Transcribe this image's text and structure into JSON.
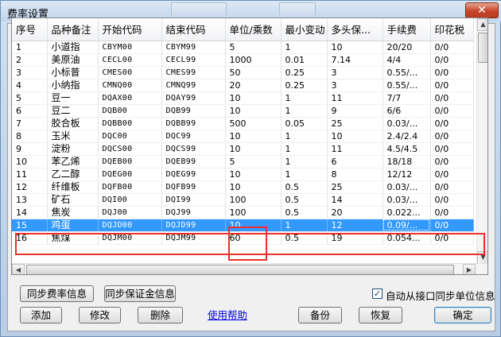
{
  "window": {
    "title": "费率设置",
    "background_tab": "费率",
    "close_glyph": "✕"
  },
  "table": {
    "columns": [
      "序号",
      "品种备注",
      "开始代码",
      "结束代码",
      "单位/乘数",
      "最小变动",
      "多头保...",
      "手续费",
      "印花税"
    ],
    "rows": [
      [
        "1",
        "小道指",
        "CBYM00",
        "CBYM99",
        "5",
        "1",
        "10",
        "20/20",
        "0/0"
      ],
      [
        "2",
        "美原油",
        "CECL00",
        "CECL99",
        "1000",
        "0.01",
        "7.14",
        "4/4",
        "0/0"
      ],
      [
        "3",
        "小标普",
        "CMES00",
        "CMES99",
        "50",
        "0.25",
        "3",
        "0.55/...",
        "0/0"
      ],
      [
        "4",
        "小纳指",
        "CMNQ00",
        "CMNQ99",
        "20",
        "0.25",
        "3",
        "0.55/...",
        "0/0"
      ],
      [
        "5",
        "豆一",
        "DQAX00",
        "DQAY99",
        "10",
        "1",
        "11",
        "7/7",
        "0/0"
      ],
      [
        "6",
        "豆二",
        "DQB00",
        "DQB99",
        "10",
        "1",
        "9",
        "6/6",
        "0/0"
      ],
      [
        "7",
        "胶合板",
        "DQBB00",
        "DQBB99",
        "500",
        "0.05",
        "25",
        "0.03/...",
        "0/0"
      ],
      [
        "8",
        "玉米",
        "DQC00",
        "DQC99",
        "10",
        "1",
        "10",
        "2.4/2.4",
        "0/0"
      ],
      [
        "9",
        "淀粉",
        "DQCS00",
        "DQCS99",
        "10",
        "1",
        "11",
        "4.5/4.5",
        "0/0"
      ],
      [
        "10",
        "苯乙烯",
        "DQEB00",
        "DQEB99",
        "5",
        "1",
        "6",
        "18/18",
        "0/0"
      ],
      [
        "11",
        "乙二醇",
        "DQEG00",
        "DQEG99",
        "10",
        "1",
        "8",
        "12/12",
        "0/0"
      ],
      [
        "12",
        "纤维板",
        "DQFB00",
        "DQFB99",
        "10",
        "0.5",
        "25",
        "0.03/...",
        "0/0"
      ],
      [
        "13",
        "矿石",
        "DQI00",
        "DQI99",
        "100",
        "0.5",
        "14",
        "0.03/...",
        "0/0"
      ],
      [
        "14",
        "焦炭",
        "DQJ00",
        "DQJ99",
        "100",
        "0.5",
        "20",
        "0.022...",
        "0/0"
      ],
      [
        "15",
        "鸡蛋",
        "DQJD00",
        "DQJD99",
        "10",
        "1",
        "12",
        "0.09/...",
        "0/0"
      ],
      [
        "16",
        "焦煤",
        "DQJM00",
        "DQJM99",
        "60",
        "0.5",
        "19",
        "0.054...",
        "0/0"
      ]
    ],
    "selected_row_index": 14
  },
  "scrollbars": {
    "up": "▲",
    "down": "▼",
    "left": "◀",
    "right": "▶"
  },
  "buttons": {
    "sync_rate": "同步费率信息",
    "sync_margin": "同步保证金信息",
    "add": "添加",
    "modify": "修改",
    "delete": "删除",
    "help": "使用帮助",
    "backup": "备份",
    "restore": "恢复",
    "ok": "确定"
  },
  "checkbox": {
    "label": "自动从接口同步单位信息",
    "checked": true,
    "mark": "✓"
  }
}
